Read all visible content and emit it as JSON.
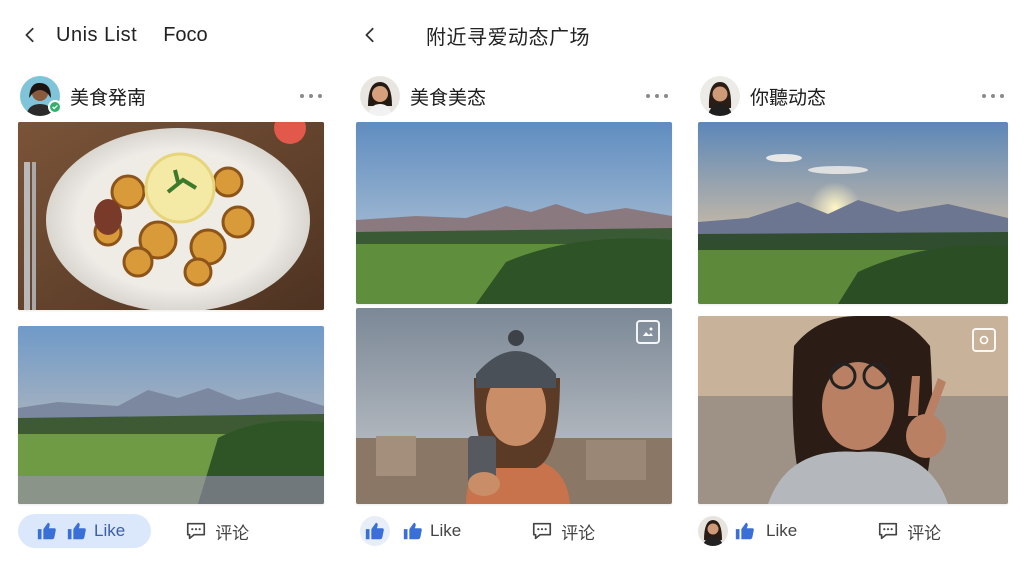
{
  "header": {
    "left_title": "Unis List",
    "left_title_2": "Foco",
    "center_title": "附近寻爱动态广场"
  },
  "columns": [
    {
      "author": "美食発南",
      "photos": [
        "food-plate",
        "mountain-landscape"
      ],
      "like_label": "Like",
      "comment_label": "评论"
    },
    {
      "author": "美食美态",
      "photos": [
        "mountain-landscape",
        "selfie-beanie"
      ],
      "like_label": "Like",
      "comment_label": "评论"
    },
    {
      "author": "你聽动态",
      "photos": [
        "sunset-mountains",
        "selfie-peace-sign"
      ],
      "like_label": "Like",
      "comment_label": "评论"
    }
  ],
  "colors": {
    "accent": "#3b6fd8",
    "like_bg": "#dbe8fb",
    "verified": "#2fb36b"
  },
  "icons": [
    "back-arrow-icon",
    "more-dots-icon",
    "thumbs-up-icon",
    "comment-icon",
    "verified-check-icon",
    "gallery-icon"
  ]
}
